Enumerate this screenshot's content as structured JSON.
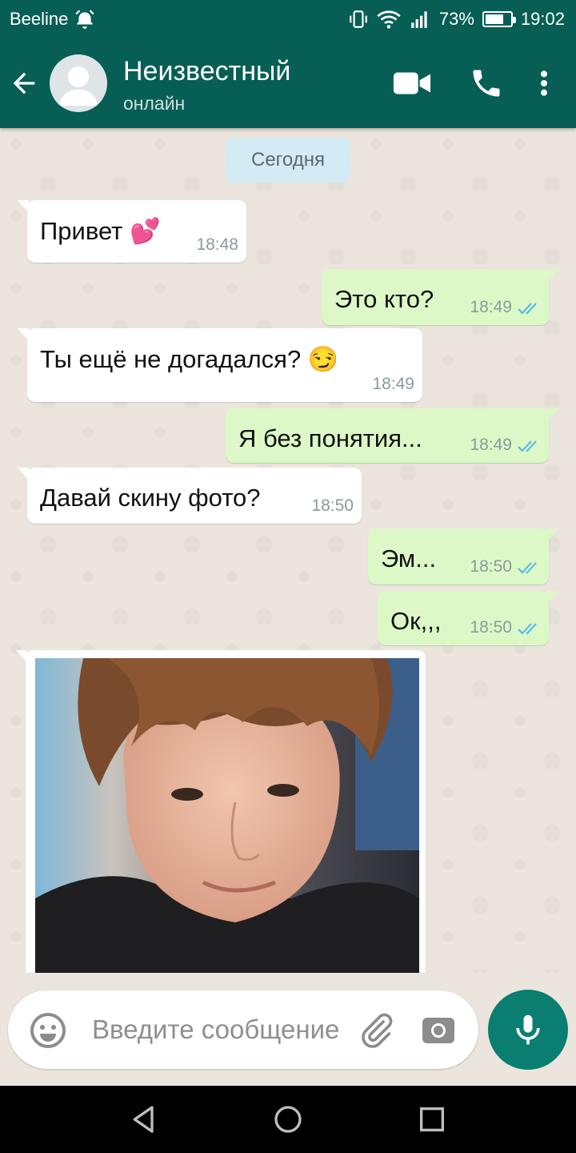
{
  "status_bar": {
    "carrier": "Beeline",
    "battery": "73%",
    "battery_level": 0.73,
    "time": "19:02"
  },
  "header": {
    "contact_name": "Неизвестный",
    "contact_status": "онлайн",
    "icons": [
      "back-arrow-icon",
      "video-call-icon",
      "phone-icon",
      "more-vert-icon"
    ]
  },
  "chat": {
    "date_label": "Сегодня",
    "messages": [
      {
        "dir": "in",
        "text": "Привет 💕",
        "time": "18:48"
      },
      {
        "dir": "out",
        "text": "Это кто?",
        "time": "18:49",
        "read": true
      },
      {
        "dir": "in",
        "text": "Ты ещё не догадался? 😏",
        "time": "18:49"
      },
      {
        "dir": "out",
        "text": "Я без понятия...",
        "time": "18:49",
        "read": true
      },
      {
        "dir": "in",
        "text": "Давай скину фото?",
        "time": "18:50"
      },
      {
        "dir": "out",
        "text": "Эм...",
        "time": "18:50",
        "read": true
      },
      {
        "dir": "out",
        "text": "Ок,,,",
        "time": "18:50",
        "read": true
      }
    ]
  },
  "composer": {
    "placeholder": "Введите сообщение"
  },
  "colors": {
    "header": "#075e54",
    "outgoing_bubble": "#dcf8c6",
    "incoming_bubble": "#ffffff",
    "mic_button": "#0a7e71",
    "read_ticks": "#4fb6ec"
  }
}
